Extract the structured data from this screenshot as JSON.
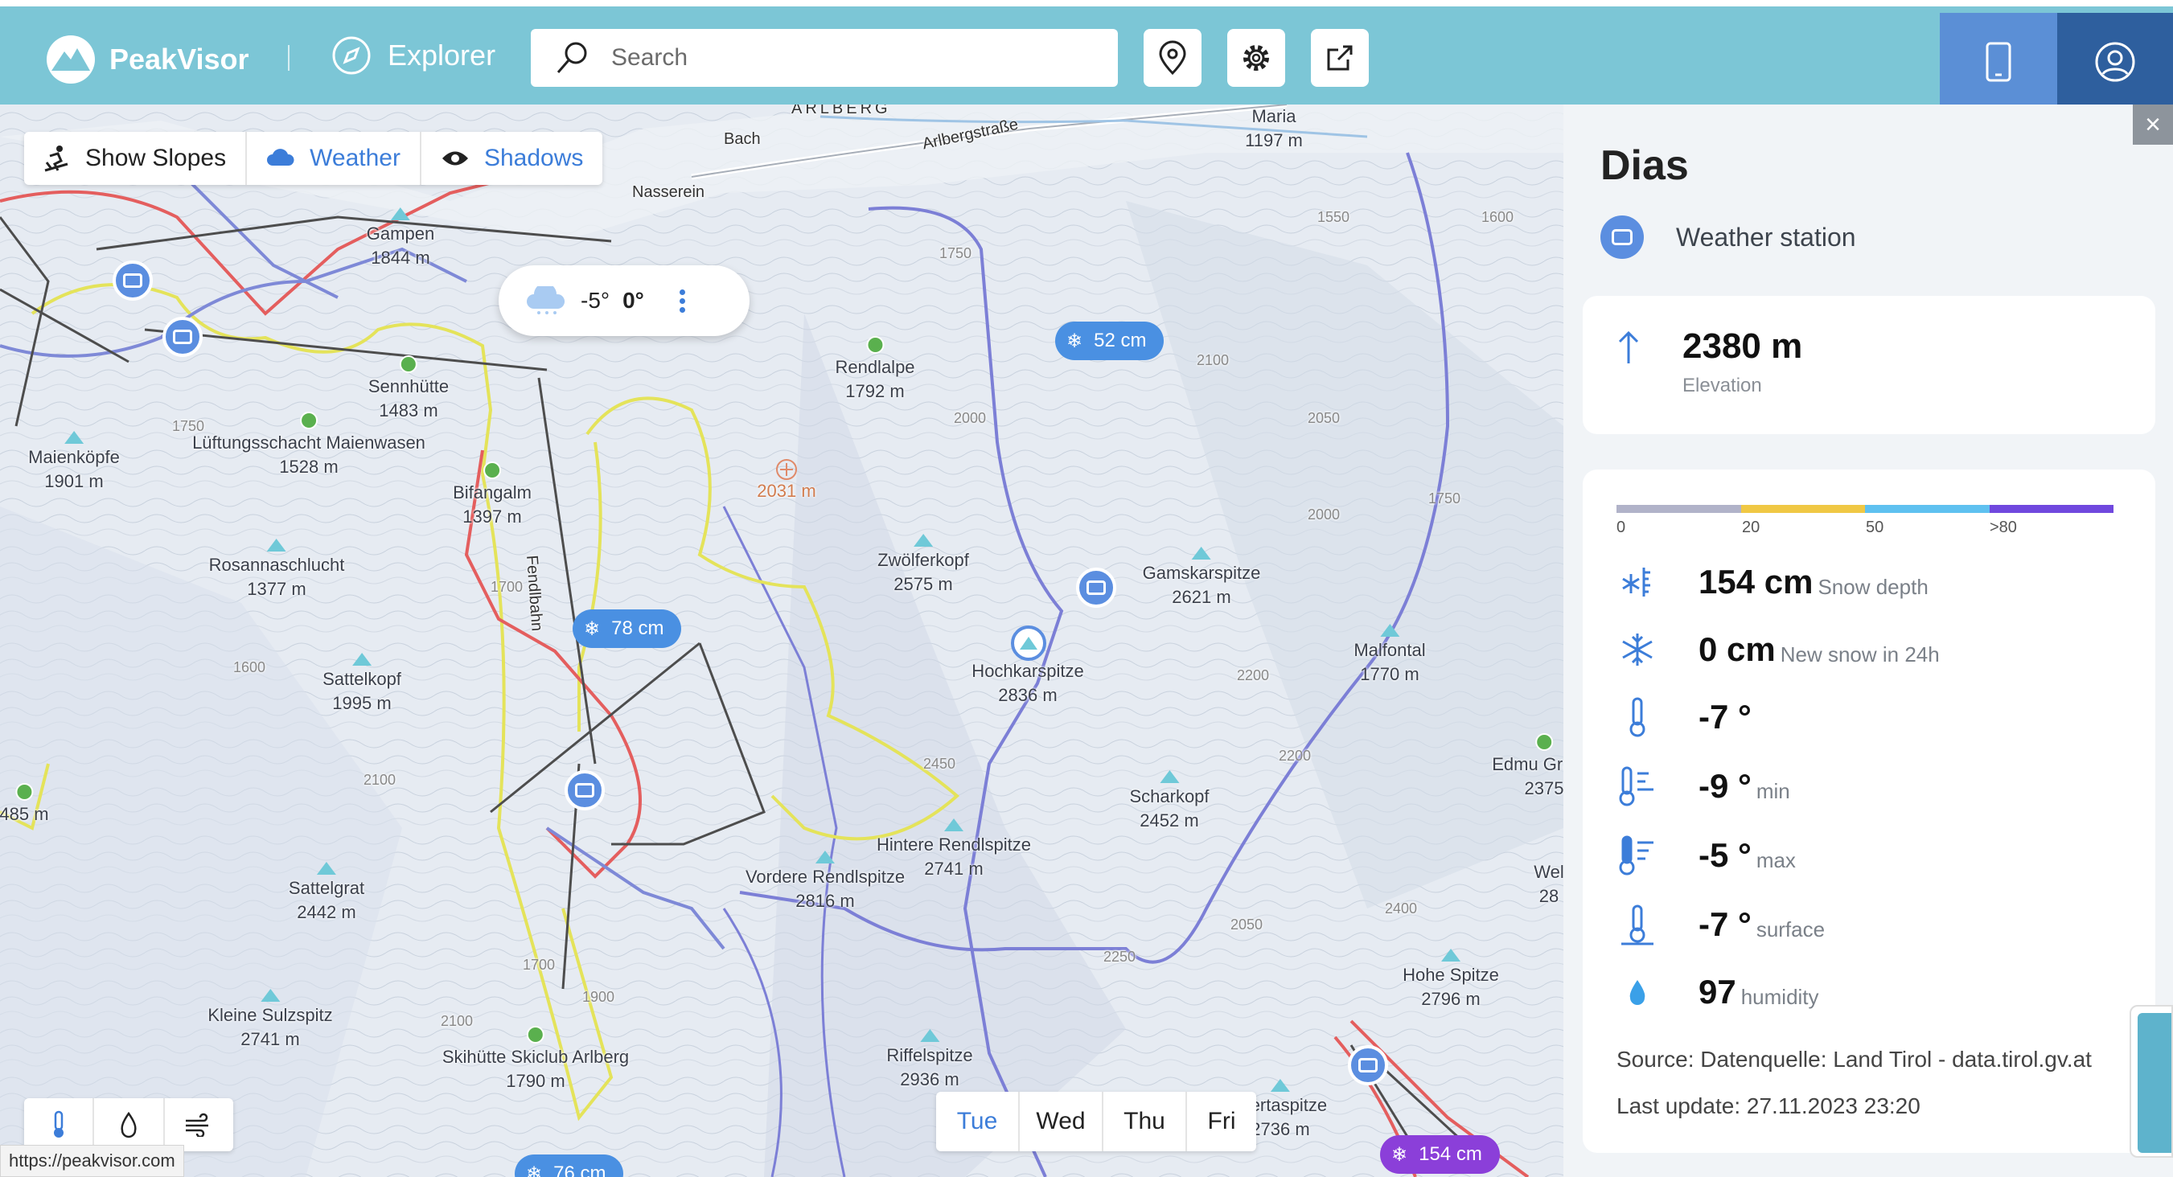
{
  "header": {
    "brand": "PeakVisor",
    "section": "Explorer",
    "search_placeholder": "Search",
    "buttons": [
      "location-pin",
      "settings-gear",
      "share-external"
    ]
  },
  "map": {
    "toolbar": [
      {
        "label": "Show Slopes",
        "icon": "skier-icon",
        "active": false
      },
      {
        "label": "Weather",
        "icon": "cloud-icon",
        "active": true
      },
      {
        "label": "Shadows",
        "icon": "eye-icon",
        "active": true
      }
    ],
    "weather_popup": {
      "min": "-5°",
      "max": "0°"
    },
    "snow_badges": [
      {
        "text": "52 cm"
      },
      {
        "text": "78 cm"
      },
      {
        "text": "154 cm"
      },
      {
        "text": "76 cm"
      }
    ],
    "region_label": "ARLBERG",
    "villages": [
      {
        "name": "Bach"
      },
      {
        "name": "Nasserein"
      },
      {
        "name": "Arlbergstraße"
      },
      {
        "name": "Fendlbahn"
      },
      {
        "name": "Maria"
      }
    ],
    "peaks": [
      {
        "name": "Gampen",
        "elev": "1844 m"
      },
      {
        "name": "Sennhütte",
        "elev": "1483 m"
      },
      {
        "name": "Lüftungsschacht Maienwasen",
        "elev": "1528 m"
      },
      {
        "name": "Maienköpfe",
        "elev": "1901 m"
      },
      {
        "name": "Bifangalm",
        "elev": "1397 m"
      },
      {
        "name": "Rosannaschlucht",
        "elev": "1377 m"
      },
      {
        "name": "Sattelkopf",
        "elev": "1995 m"
      },
      {
        "name": "Sattelgrat",
        "elev": "2442 m"
      },
      {
        "name": "Kleine Sulzspitz",
        "elev": "2741 m"
      },
      {
        "name": "Skihütte Skiclub Arlberg",
        "elev": "1790 m"
      },
      {
        "name": "Rendlalpe",
        "elev": "1792 m"
      },
      {
        "name": "",
        "elev": "2031 m"
      },
      {
        "name": "Zwölferkopf",
        "elev": "2575 m"
      },
      {
        "name": "Gamskarspitze",
        "elev": "2621 m"
      },
      {
        "name": "Hochkarspitze",
        "elev": "2836 m"
      },
      {
        "name": "Malfontal",
        "elev": "1770 m"
      },
      {
        "name": "Scharkopf",
        "elev": "2452 m"
      },
      {
        "name": "Hintere Rendlspitze",
        "elev": "2741 m"
      },
      {
        "name": "Vordere Rendlspitze",
        "elev": "2816 m"
      },
      {
        "name": "Riffelspitze",
        "elev": "2936 m"
      },
      {
        "name": "Hohe Spitze",
        "elev": "2796 m"
      },
      {
        "name": "Stertaspitze",
        "elev": "2736 m"
      },
      {
        "name": "Maria",
        "elev": "1197 m"
      },
      {
        "name": "",
        "elev": "485 m"
      },
      {
        "name": "Edmu Graf-H",
        "elev": "2375"
      },
      {
        "name": "Wel",
        "elev": "28"
      }
    ],
    "contour_labels": [
      "1750",
      "1550",
      "1600",
      "2100",
      "2050",
      "2000",
      "1700",
      "1750",
      "1600",
      "2200",
      "2100",
      "2450",
      "2400",
      "1900",
      "2100",
      "2250",
      "2050",
      "2200",
      "2000",
      "1700",
      "1750"
    ],
    "layer_buttons": [
      "temperature-icon",
      "precipitation-icon",
      "wind-icon"
    ],
    "url_hint": "https://peakvisor.com",
    "days": [
      {
        "label": "Tue",
        "active": true
      },
      {
        "label": "Wed",
        "active": false
      },
      {
        "label": "Thu",
        "active": false
      },
      {
        "label": "Fri",
        "active": false
      }
    ]
  },
  "panel": {
    "title": "Dias",
    "type": "Weather station",
    "elevation": {
      "value": "2380 m",
      "label": "Elevation"
    },
    "snow_scale": {
      "labels": [
        "0",
        "20",
        "50",
        ">80"
      ],
      "colors": [
        "#b1b3c9",
        "#f0c844",
        "#5fc1f0",
        "#7048de"
      ]
    },
    "metrics": [
      {
        "icon": "snow-gauge-icon",
        "value": "154 cm",
        "unit": "Snow depth"
      },
      {
        "icon": "snowflake-icon",
        "value": "0 cm",
        "unit": "New snow in 24h"
      },
      {
        "icon": "thermometer-icon",
        "value": "-7 °",
        "unit": ""
      },
      {
        "icon": "thermometer-min-icon",
        "value": "-9 °",
        "unit": "min"
      },
      {
        "icon": "thermometer-max-icon",
        "value": "-5 °",
        "unit": "max"
      },
      {
        "icon": "thermometer-surface-icon",
        "value": "-7 °",
        "unit": "surface"
      },
      {
        "icon": "droplet-icon",
        "value": "97",
        "unit": "humidity"
      }
    ],
    "source": "Source: Datenquelle: Land Tirol - data.tirol.gv.at",
    "last_update": "Last update: 27.11.2023 23:20"
  },
  "colors": {
    "header_bg": "#7cc6d6",
    "accent_blue": "#3c7dd9",
    "device_btn": "#5b8fd6",
    "account_btn": "#2e5f9e",
    "snow_badge_blue": "#4a90e2",
    "snow_badge_purple": "#8b3fd9"
  }
}
